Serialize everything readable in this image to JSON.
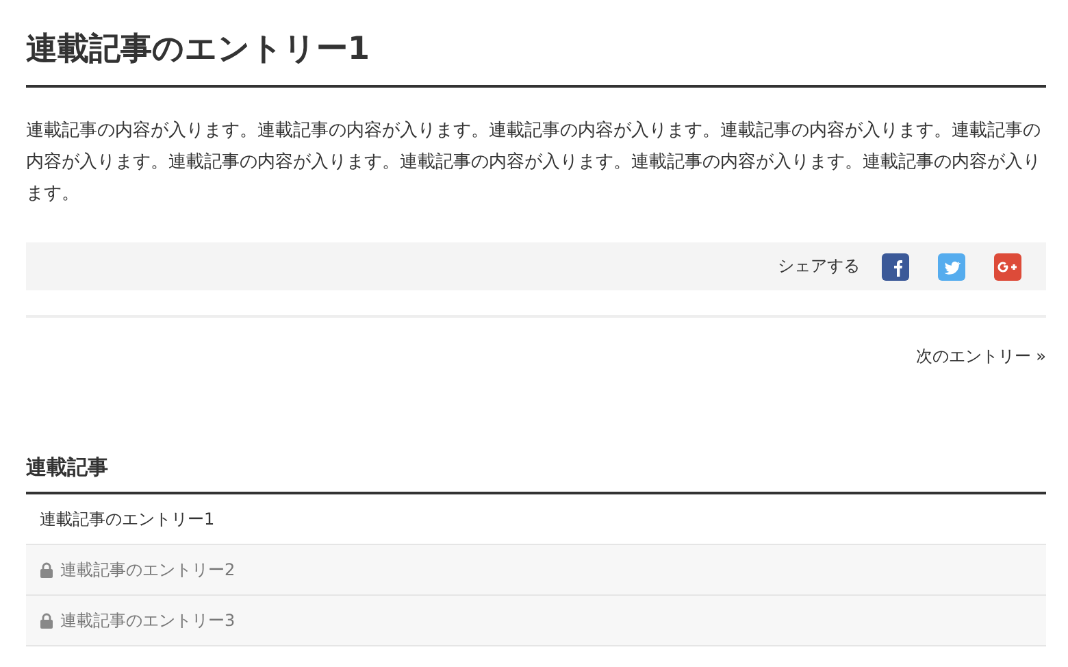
{
  "title": "連載記事のエントリー1",
  "body": "連載記事の内容が入ります。連載記事の内容が入ります。連載記事の内容が入ります。連載記事の内容が入ります。連載記事の内容が入ります。連載記事の内容が入ります。連載記事の内容が入ります。連載記事の内容が入ります。連載記事の内容が入ります。",
  "share": {
    "label": "シェアする",
    "buttons": [
      {
        "kind": "facebook"
      },
      {
        "kind": "twitter"
      },
      {
        "kind": "googleplus"
      }
    ]
  },
  "next_link": "次のエントリー »",
  "series": {
    "heading": "連載記事",
    "items": [
      {
        "label": "連載記事のエントリー1",
        "locked": false
      },
      {
        "label": "連載記事のエントリー2",
        "locked": true
      },
      {
        "label": "連載記事のエントリー3",
        "locked": true
      }
    ]
  }
}
